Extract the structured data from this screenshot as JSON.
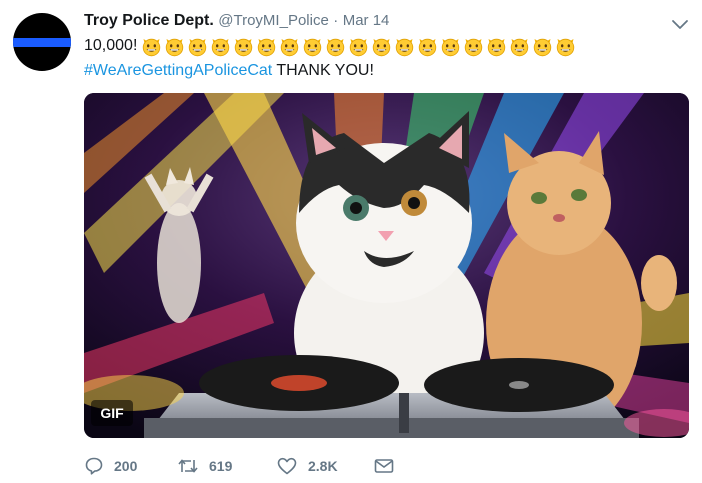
{
  "tweet": {
    "author_name": "Troy Police Dept.",
    "handle": "@TroyMI_Police",
    "separator": "·",
    "date": "Mar 14",
    "line1_text": "10,000!",
    "emoji_icon": "grinning-cat-face-icon",
    "emoji_count": 19,
    "hashtag": "#WeAreGettingAPoliceCat",
    "line2_text": "THANK YOU!",
    "media_badge": "GIF",
    "media_description_icon": "dj-cat-gif",
    "reply_count": "200",
    "retweet_count": "619",
    "like_count": "2.8K"
  },
  "colors": {
    "link": "#1b95e0",
    "secondary_text": "#657786",
    "avatar_stripe": "#1a5cff"
  }
}
